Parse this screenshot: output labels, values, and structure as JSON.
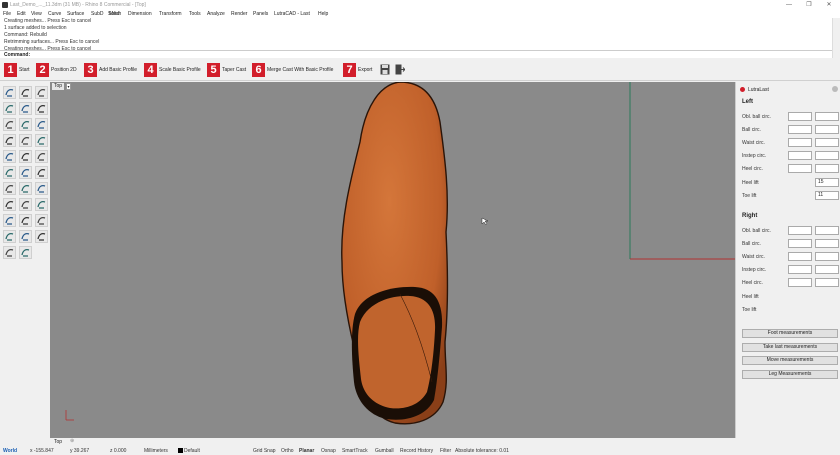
{
  "window": {
    "title": "Last_Demo_..._11.3dm (31 MB) - Rhino 8 Commercial - [Top]",
    "controls": [
      "—",
      "❐",
      "✕"
    ]
  },
  "menu": [
    "File",
    "Edit",
    "View",
    "Curve",
    "Surface",
    "SubD",
    "Solid",
    "Mesh",
    "Dimension",
    "Transform",
    "Tools",
    "Analyze",
    "Render",
    "Panels",
    "LutraCAD - Last",
    "Help"
  ],
  "command_history": [
    "Creating meshes... Press Esc to cancel",
    "1 surface added to selection",
    "Command: Rebuild",
    "Retrimming surfaces... Press Esc to cancel",
    "Creating meshes... Press Esc to cancel"
  ],
  "command_prompt": "Command:",
  "workflow": {
    "steps": [
      {
        "num": "1",
        "label": "Start"
      },
      {
        "num": "2",
        "label": "Position 2D"
      },
      {
        "num": "3",
        "label": "Add Basic Profile"
      },
      {
        "num": "4",
        "label": "Scale Basic Profile"
      },
      {
        "num": "5",
        "label": "Taper Cast"
      },
      {
        "num": "6",
        "label": "Merge Cast With Basic Profile"
      },
      {
        "num": "7",
        "label": "Export"
      }
    ],
    "save_icon": "save-icon",
    "exit_icon": "exit-icon"
  },
  "viewport": {
    "name": "Top",
    "dropdown": "▾"
  },
  "panel": {
    "title": "LutraLast",
    "left_section": "Left",
    "right_section": "Right",
    "left_rows": [
      {
        "label": "Obl. ball circ.",
        "v1": "",
        "v2": ""
      },
      {
        "label": "Ball circ.",
        "v1": "",
        "v2": ""
      },
      {
        "label": "Waist circ.",
        "v1": "",
        "v2": ""
      },
      {
        "label": "Instep circ.",
        "v1": "",
        "v2": ""
      },
      {
        "label": "Heel circ.",
        "v1": "",
        "v2": ""
      }
    ],
    "left_heel_lift": {
      "label": "Heel lift",
      "value": "15"
    },
    "left_toe_lift": {
      "label": "Toe lift",
      "value": "11"
    },
    "right_rows": [
      {
        "label": "Obl. ball circ.",
        "v1": "",
        "v2": ""
      },
      {
        "label": "Ball circ.",
        "v1": "",
        "v2": ""
      },
      {
        "label": "Waist circ.",
        "v1": "",
        "v2": ""
      },
      {
        "label": "Instep circ.",
        "v1": "",
        "v2": ""
      },
      {
        "label": "Heel circ.",
        "v1": "",
        "v2": ""
      }
    ],
    "right_heel_lift": {
      "label": "Heel lift",
      "value": ""
    },
    "right_toe_lift": {
      "label": "Toe lift",
      "value": ""
    },
    "buttons": [
      "Foot measurements",
      "Take last measurements",
      "Move measurements",
      "Leg Measurements"
    ]
  },
  "status": {
    "viewport_tab": "Top",
    "cplane": "World",
    "x": "x -155.847",
    "y": "y 39.267",
    "z": "z 0.000",
    "units": "Millimeters",
    "layer": "Default",
    "toggles": [
      "Grid Snap",
      "Ortho",
      "Planar",
      "Osnap",
      "SmartTrack",
      "Gumball",
      "Record History",
      "Filter"
    ],
    "tolerance": "Absolute tolerance: 0.01"
  },
  "colors": {
    "accent_red": "#d21e2b",
    "viewport_bg": "#8a8a8a",
    "model": "#c8662e"
  }
}
